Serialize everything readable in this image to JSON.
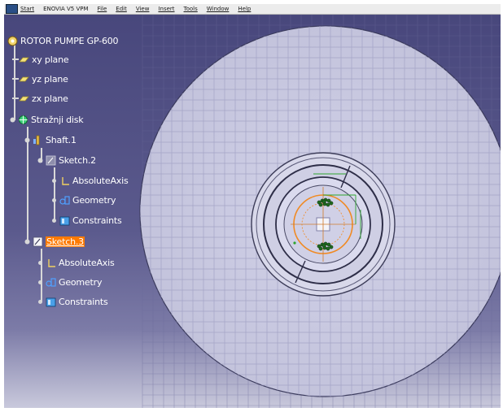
{
  "menu": {
    "items": [
      "Start",
      "ENOVIA V5 VPM",
      "File",
      "Edit",
      "View",
      "Insert",
      "Tools",
      "Window",
      "Help"
    ]
  },
  "tree": {
    "root": "ROTOR PUMPE GP-600",
    "planes": [
      "xy plane",
      "yz plane",
      "zx plane"
    ],
    "body": "Stražnji disk",
    "shaft": "Shaft.1",
    "sketch2": {
      "label": "Sketch.2",
      "children": [
        "AbsoluteAxis",
        "Geometry",
        "Constraints"
      ]
    },
    "sketch3": {
      "label": "Sketch.3",
      "children": [
        "AbsoluteAxis",
        "Geometry",
        "Constraints"
      ]
    }
  },
  "colors": {
    "background_top": "#48477c",
    "background_bottom": "#c9c9dc",
    "disk": "#cbcbe2",
    "grid": "#a7a7c8",
    "selection": "#ff7a00",
    "sketch_orange": "#f08a24",
    "constraint_green": "#2ea52e"
  }
}
